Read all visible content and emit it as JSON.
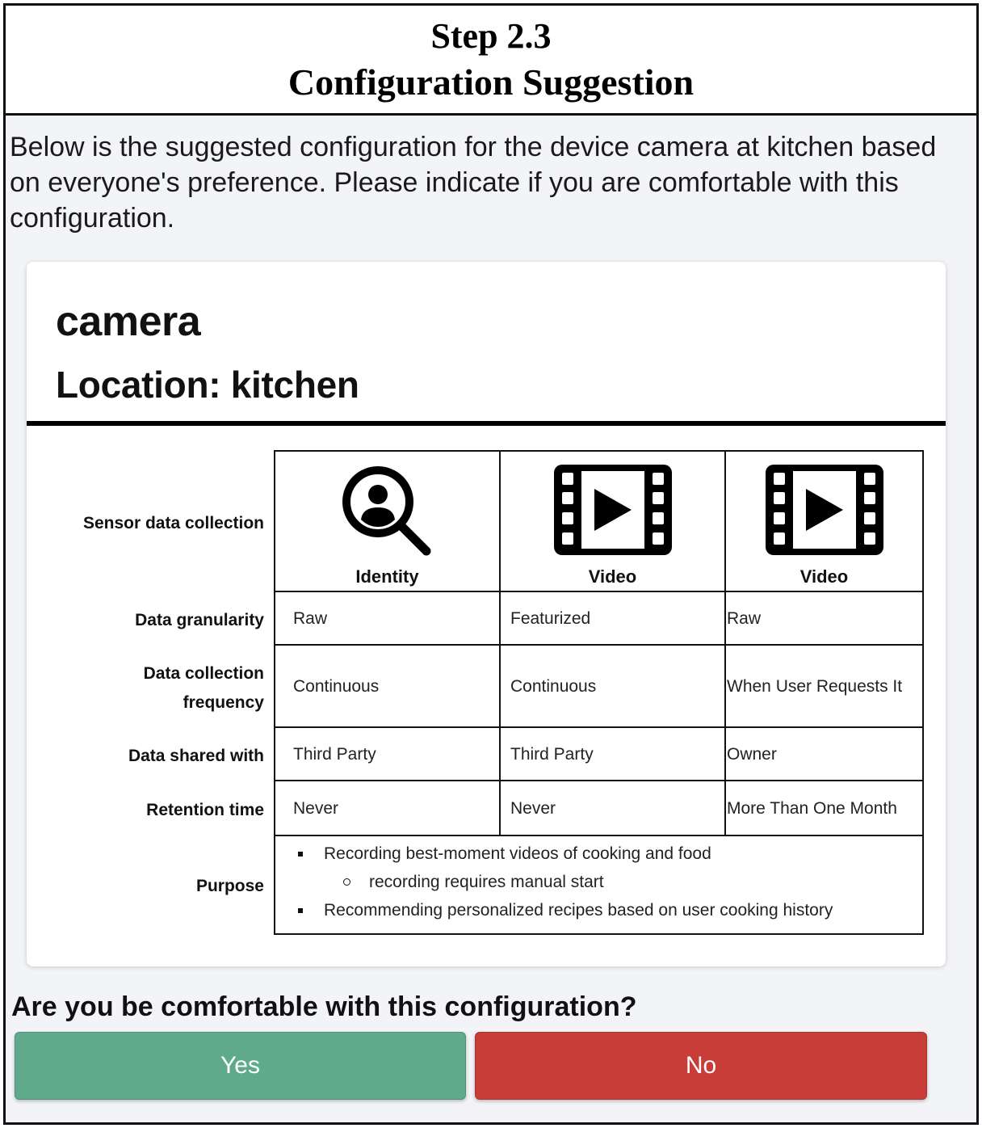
{
  "header": {
    "step": "Step 2.3",
    "title": "Configuration Suggestion"
  },
  "intro_text": "Below is the suggested configuration for the device camera at kitchen based on everyone's preference. Please indicate if you are comfortable with this configuration.",
  "card": {
    "device_name": "camera",
    "location": "Location: kitchen"
  },
  "row_labels": {
    "sensor": "Sensor data collection",
    "granularity": "Data granularity",
    "frequency_line1": "Data collection",
    "frequency_line2": "frequency",
    "shared": "Data shared with",
    "retention": "Retention time",
    "purpose": "Purpose"
  },
  "columns": [
    {
      "icon": "identity-search-icon",
      "sensor": "Identity",
      "granularity": "Raw",
      "frequency": "Continuous",
      "shared": "Third Party",
      "retention": "Never"
    },
    {
      "icon": "video-film-icon",
      "sensor": "Video",
      "granularity": "Featurized",
      "frequency": "Continuous",
      "shared": "Third Party",
      "retention": "Never"
    },
    {
      "icon": "video-film-icon",
      "sensor": "Video",
      "granularity": "Raw",
      "frequency": "When User Requests It",
      "shared": "Owner",
      "retention": "More Than One Month"
    }
  ],
  "purpose": {
    "item1": "Recording best-moment videos of cooking and food",
    "item1_sub": "recording requires manual start",
    "item2": "Recommending personalized recipes based on user cooking history"
  },
  "question": "Are you be comfortable with this configuration?",
  "buttons": {
    "yes": "Yes",
    "no": "No"
  },
  "colors": {
    "yes": "#5faa8b",
    "no": "#c93d38"
  }
}
